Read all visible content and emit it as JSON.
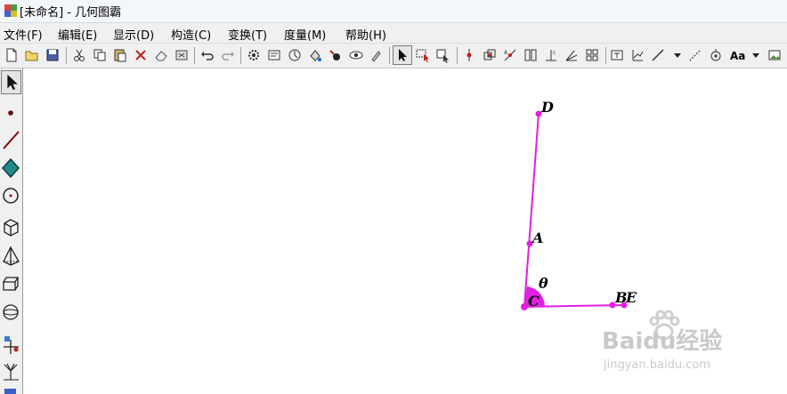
{
  "window": {
    "title": "[未命名] - 几何图霸"
  },
  "menu": {
    "items": [
      "文件(F)",
      "编辑(E)",
      "显示(D)",
      "构造(C)",
      "变换(T)",
      "度量(M)",
      "帮助(H)"
    ]
  },
  "toolbar": {
    "font_label": "Aa"
  },
  "toolbox": {
    "tools": [
      "arrow-select",
      "point",
      "segment",
      "polygon",
      "circle",
      "cube",
      "pyramid",
      "prism",
      "sphere",
      "custom-tool",
      "more-tools"
    ]
  },
  "sketch": {
    "points": [
      "D",
      "A",
      "C",
      "B",
      "E"
    ],
    "angle_label": "θ",
    "color": "#e020e0"
  },
  "watermark": {
    "brand": "Baidu经验",
    "url": "jingyan.baidu.com"
  }
}
